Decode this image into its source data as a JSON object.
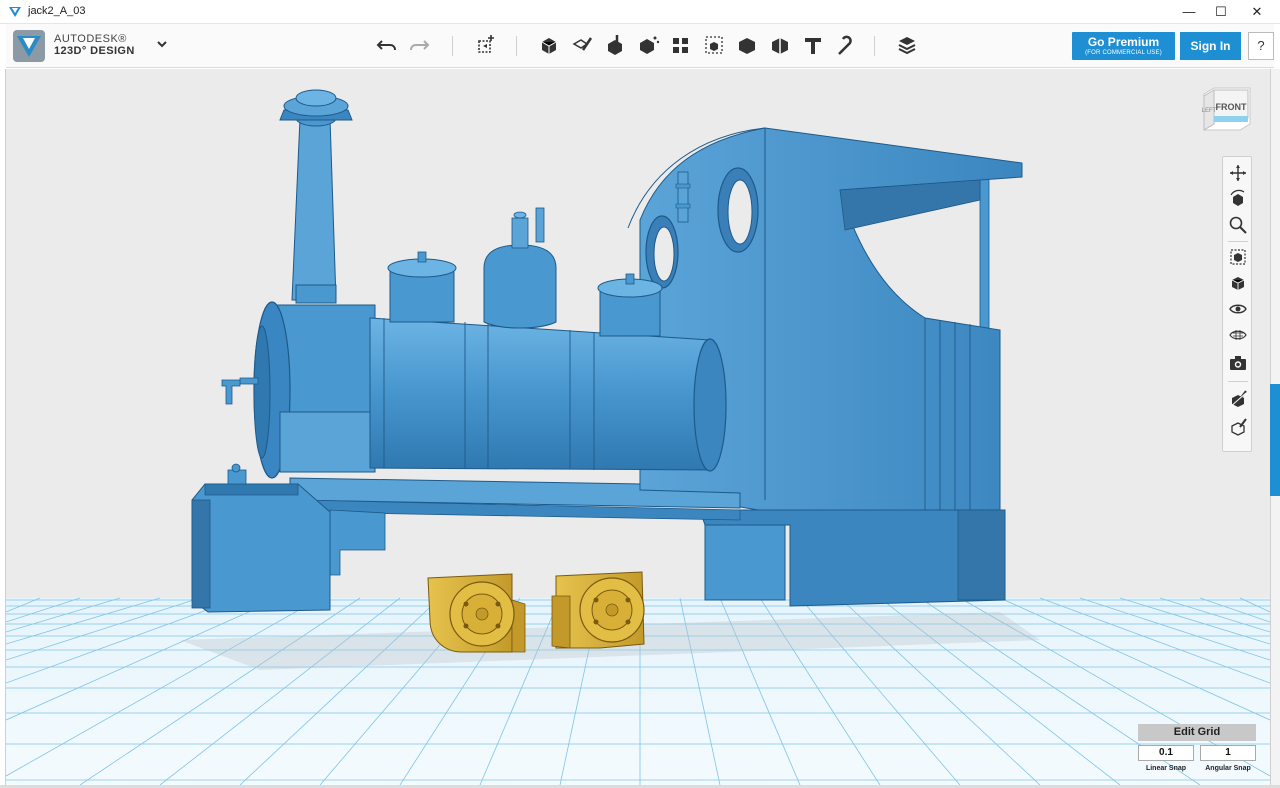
{
  "window": {
    "title": "jack2_A_03",
    "minimize_glyph": "—",
    "maximize_glyph": "☐",
    "close_glyph": "✕"
  },
  "brand": {
    "line1": "AUTODESK®",
    "line2": "123D° DESIGN"
  },
  "toolbar": {
    "tools": [
      "undo-icon",
      "redo-icon",
      "transform-icon",
      "primitives-icon",
      "sketch-icon",
      "construct-icon",
      "modify-icon",
      "pattern-icon",
      "group-icon",
      "combine-icon",
      "measure-icon",
      "text-icon",
      "snap-icon",
      "material-icon"
    ]
  },
  "account": {
    "premium_label": "Go Premium",
    "premium_sub": "(FOR COMMERCIAL USE)",
    "signin_label": "Sign In",
    "help_label": "?"
  },
  "viewcube": {
    "face_label": "FRONT",
    "side_label": "LEFT"
  },
  "navigation": {
    "tools": [
      "pan-icon",
      "orbit-icon",
      "zoom-icon",
      "fit-icon",
      "view-mode-icon",
      "visibility-icon",
      "materials-visibility-icon",
      "snapshot-icon",
      "show-hide-icon",
      "outline-icon"
    ]
  },
  "grid": {
    "edit_label": "Edit Grid",
    "linear_snap_value": "0.1",
    "angular_snap_value": "1",
    "linear_snap_label": "Linear Snap",
    "angular_snap_label": "Angular Snap"
  },
  "colors": {
    "accent": "#1e8fd2",
    "model_blue": "#4a98d0",
    "model_gold": "#d8b038",
    "grid_line": "#7fc4e8"
  }
}
